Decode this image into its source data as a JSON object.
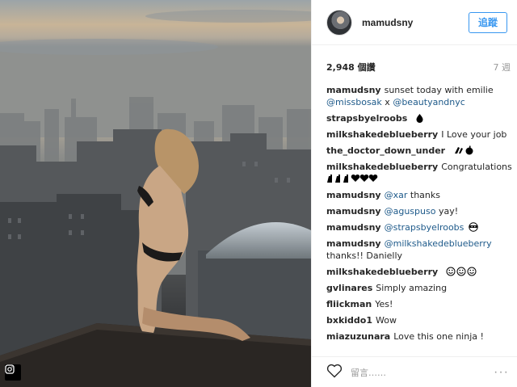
{
  "header": {
    "username": "mamudsny",
    "follow_label": "追蹤"
  },
  "meta": {
    "likes": "2,948 個讚",
    "age": "7 週"
  },
  "caption": {
    "user": "mamudsny",
    "text": "sunset today with emilie",
    "mention_1": "@missbosak",
    "sep": " x ",
    "mention_2": "@beautyandnyc"
  },
  "comments": [
    {
      "user": "strapsbyelroobs",
      "text": ""
    },
    {
      "user": "milkshakedeblueberry",
      "text": "I Love your job"
    },
    {
      "user": "the_doctor_down_under",
      "text": ""
    },
    {
      "user": "milkshakedeblueberry",
      "text": "Congratulations"
    },
    {
      "user": "mamudsny",
      "mention": "@xar",
      "text": "thanks"
    },
    {
      "user": "mamudsny",
      "mention": "@aguspuso",
      "text": "yay!"
    },
    {
      "user": "mamudsny",
      "mention": "@strapsbyelroobs",
      "text": ""
    },
    {
      "user": "mamudsny",
      "mention": "@milkshakedeblueberry",
      "text": "thanks!! Danielly"
    },
    {
      "user": "milkshakedeblueberry",
      "text": ""
    },
    {
      "user": "gvlinares",
      "text": "Simply amazing"
    },
    {
      "user": "fliickman",
      "text": "Yes!"
    },
    {
      "user": "bxkiddo1",
      "text": "Wow"
    },
    {
      "user": "miazuzunara",
      "text": "Love this one ninja !"
    }
  ],
  "footer": {
    "placeholder": "留言……",
    "more": "···"
  },
  "icons": {
    "heart": "heart-outline-icon",
    "more": "more-options-icon",
    "instagram": "instagram-glyph-icon"
  },
  "colors": {
    "link": "#1e5a8a",
    "follow": "#3897f0"
  }
}
